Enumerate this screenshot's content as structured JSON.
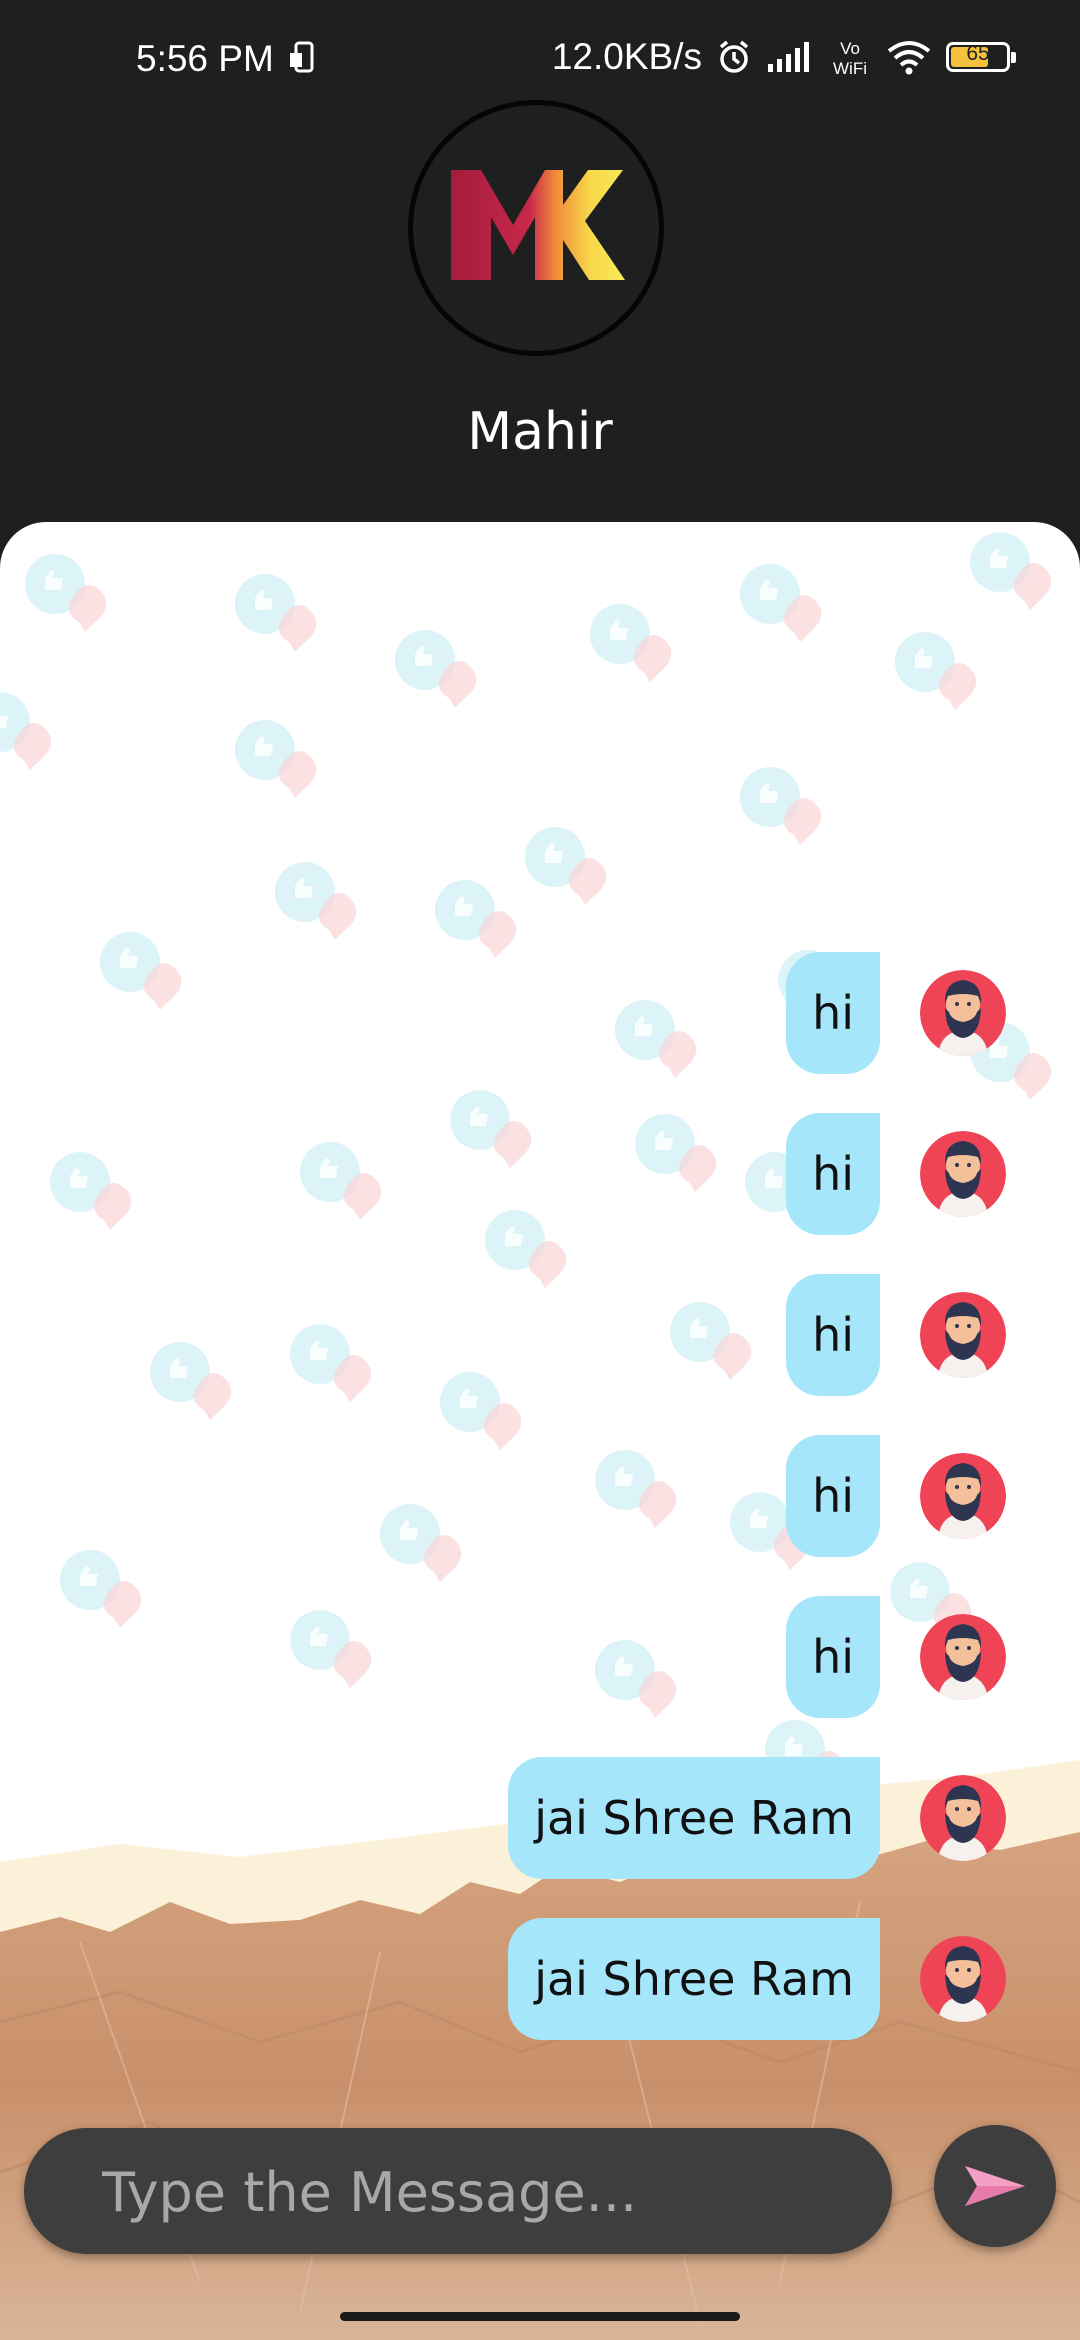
{
  "status_bar": {
    "time": "5:56 PM",
    "network_speed": "12.0KB/s",
    "battery_level": "65",
    "icons": [
      "screenshot-icon",
      "alarm-icon",
      "signal-icon",
      "vowifi-icon",
      "wifi-icon",
      "battery-icon"
    ]
  },
  "header": {
    "logo_text": "MK",
    "contact_name": "Mahir"
  },
  "messages": [
    {
      "text": "hi",
      "sender": "me"
    },
    {
      "text": "hi",
      "sender": "me"
    },
    {
      "text": "hi",
      "sender": "me"
    },
    {
      "text": "hi",
      "sender": "me"
    },
    {
      "text": "hi",
      "sender": "me"
    },
    {
      "text": "jai Shree Ram",
      "sender": "me"
    },
    {
      "text": "jai Shree Ram",
      "sender": "me"
    }
  ],
  "composer": {
    "placeholder": "Type the Message...",
    "value": "",
    "send_icon": "send-icon"
  },
  "colors": {
    "bubble": "#a6e6fb",
    "header_bg": "#1e1f1f",
    "input_bg": "#3e3e3e",
    "send_accent": "#f4a0c4"
  }
}
